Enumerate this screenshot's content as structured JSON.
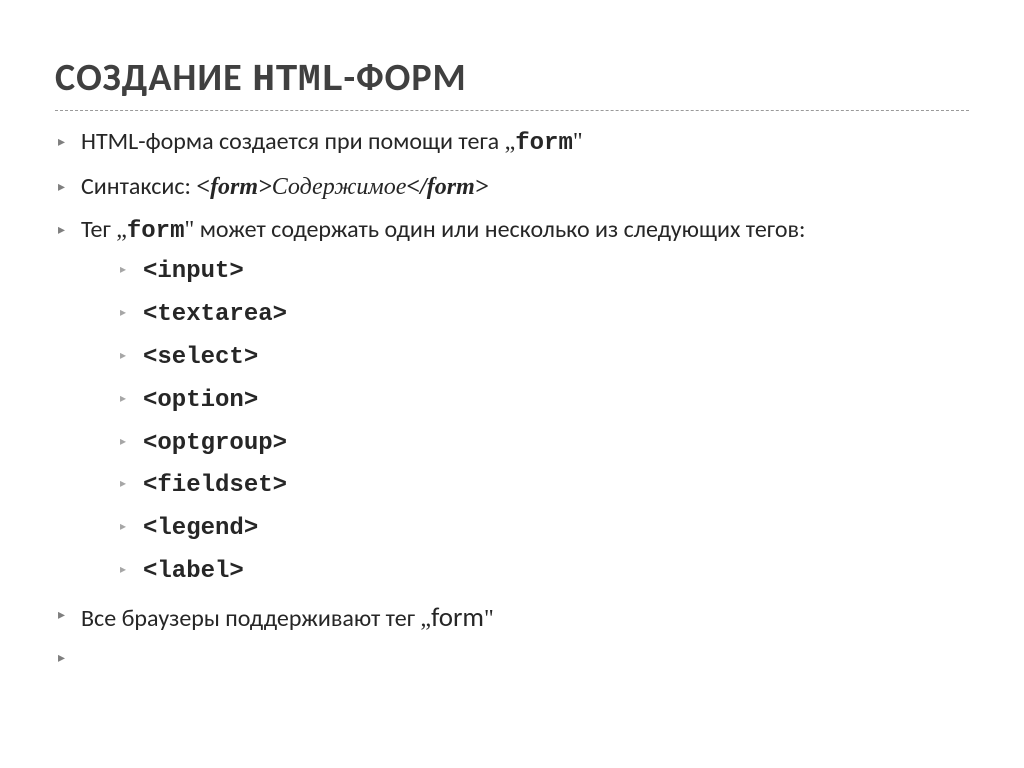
{
  "title_pre": "СОЗДАНИЕ ",
  "title_html": "HTML",
  "title_post": "-ФОРМ",
  "ql": "„",
  "qr": "\"",
  "bullets": {
    "b0_a": "HTML",
    "b0_b": "-форма создается при помощи тега  ",
    "b0_c": "form",
    "b1_a": "Синтаксис: ",
    "b1_b": "<form>",
    "b1_c": "Содержимое",
    "b1_d": "</form>",
    "b2_a": "Тег  ",
    "b2_b": "form",
    "b2_c": "  может содержать один или несколько из следующих тегов:",
    "b3_a": "Все браузеры поддерживают тег  ",
    "b3_b": "form"
  },
  "tags": [
    "<input>",
    "<textarea>",
    "<select>",
    "<option>",
    "<optgroup>",
    "<fieldset>",
    "<legend>",
    "<label>"
  ]
}
